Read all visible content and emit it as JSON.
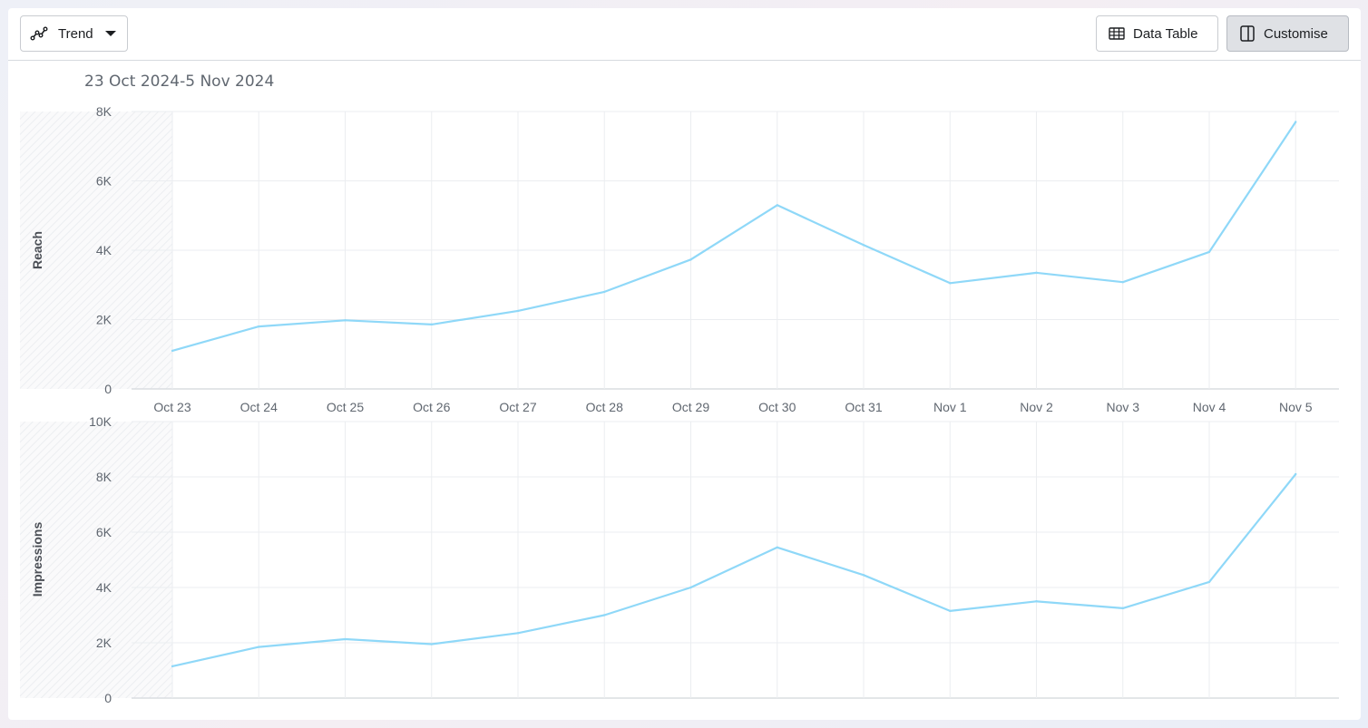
{
  "toolbar": {
    "trend_label": "Trend",
    "trend_icon": "trend-line-icon",
    "data_table_label": "Data Table",
    "data_table_icon": "table-icon",
    "customise_label": "Customise",
    "customise_icon": "panel-icon"
  },
  "date_range": "23 Oct 2024-5 Nov 2024",
  "colors": {
    "series": "#8fd8f8",
    "grid": "#ebedf0",
    "axis_text": "#606770",
    "shade": "#f1f2f4"
  },
  "chart_data": [
    {
      "type": "line",
      "ylabel": "Reach",
      "xlabel": "",
      "x": [
        "Oct 23",
        "Oct 24",
        "Oct 25",
        "Oct 26",
        "Oct 27",
        "Oct 28",
        "Oct 29",
        "Oct 30",
        "Oct 31",
        "Nov 1",
        "Nov 2",
        "Nov 3",
        "Nov 4",
        "Nov 5"
      ],
      "values": [
        1100,
        1800,
        1980,
        1860,
        2250,
        2800,
        3730,
        5300,
        4150,
        3050,
        3350,
        3080,
        3950,
        7700
      ],
      "ylim": [
        0,
        8000
      ],
      "yticks": [
        "0",
        "2K",
        "4K",
        "6K",
        "8K"
      ],
      "grid": true
    },
    {
      "type": "line",
      "ylabel": "Impressions",
      "xlabel": "",
      "x": [
        "Oct 23",
        "Oct 24",
        "Oct 25",
        "Oct 26",
        "Oct 27",
        "Oct 28",
        "Oct 29",
        "Oct 30",
        "Oct 31",
        "Nov 1",
        "Nov 2",
        "Nov 3",
        "Nov 4",
        "Nov 5"
      ],
      "values": [
        1150,
        1850,
        2130,
        1950,
        2350,
        3000,
        4000,
        5450,
        4450,
        3150,
        3500,
        3250,
        4200,
        8100
      ],
      "ylim": [
        0,
        10000
      ],
      "yticks": [
        "0",
        "2K",
        "4K",
        "6K",
        "8K",
        "10K"
      ],
      "grid": true
    }
  ]
}
